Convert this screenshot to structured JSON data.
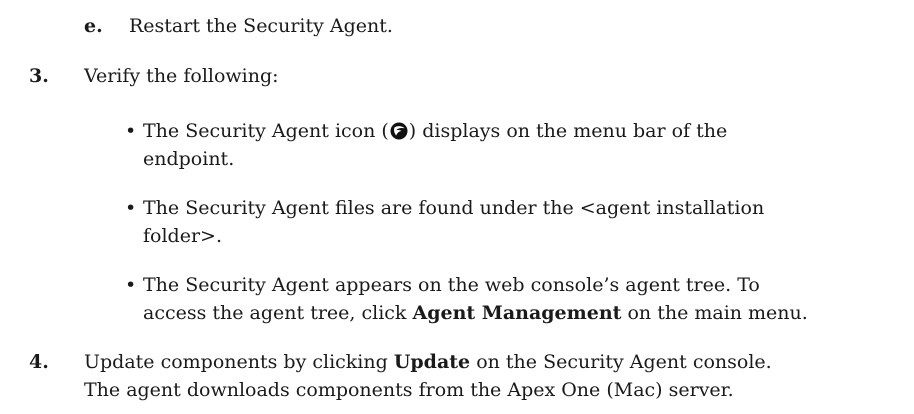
{
  "doc": {
    "step_e": {
      "marker": "e.",
      "text": "Restart the Security Agent."
    },
    "step3": {
      "marker": "3.",
      "text": "Verify the following:",
      "bullet_symbol": "•",
      "bullet1": {
        "before": "The Security Agent icon (",
        "icon": "security-agent-icon",
        "after": ") displays on the menu bar of the",
        "line2": "endpoint."
      },
      "bullet2": {
        "line1": "The Security Agent files are found under the <agent installation",
        "line2": "folder>."
      },
      "bullet3": {
        "line1": "The Security Agent appears on the web console’s agent tree. To",
        "line2_before": "access the agent tree, click ",
        "line2_bold": "Agent Management",
        "line2_after": " on the main menu."
      }
    },
    "step4": {
      "marker": "4.",
      "line1_before": "Update components by clicking ",
      "line1_bold": "Update",
      "line1_after": " on the Security Agent console.",
      "line2": "The agent downloads components from the Apex One (Mac) server."
    }
  }
}
